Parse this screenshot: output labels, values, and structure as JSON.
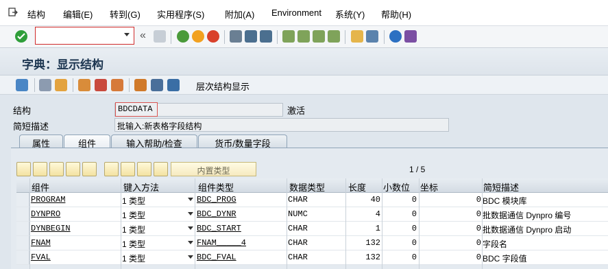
{
  "menu": {
    "items": [
      "结构(S)",
      "编辑(E)",
      "转到(G)",
      "实用程序(S)",
      "附加(A)",
      "Environment",
      "系统(Y)",
      "帮助(H)"
    ]
  },
  "menu_labels": {
    "struct": "结构",
    "edit": "编辑(E)",
    "goto": "转到(G)",
    "util": "实用程序(S)",
    "extras": "附加(A)",
    "env": "Environment",
    "system": "系统(Y)",
    "help": "帮助(H)"
  },
  "toolbar": {
    "command_value": "",
    "back_arrows": "«"
  },
  "title": "字典：显示结构",
  "app_toolbar": {
    "hierarchy_label": "层次结构显示"
  },
  "form": {
    "struct_label": "结构",
    "struct_value": "BDCDATA",
    "status": "激活",
    "desc_label": "简短描述",
    "desc_value": "批输入:新表格字段结构"
  },
  "tabs": [
    "属性",
    "组件",
    "输入帮助/检查",
    "货币/数量字段"
  ],
  "table": {
    "builtin_type_label": "内置类型",
    "pager": "1 / 5",
    "headers": [
      "组件",
      "键入方法",
      "组件类型",
      "数据类型",
      "长度",
      "小数位",
      "坐标",
      "简短描述"
    ],
    "rows": [
      {
        "component": "PROGRAM",
        "method": "1 类型",
        "comp_type": "BDC_PROG",
        "data_type": "CHAR",
        "length": "40",
        "decimals": "0",
        "coord": "0",
        "desc": "BDC 模块库"
      },
      {
        "component": "DYNPRO",
        "method": "1 类型",
        "comp_type": "BDC_DYNR",
        "data_type": "NUMC",
        "length": "4",
        "decimals": "0",
        "coord": "0",
        "desc": "批数据通信 Dynpro 编号"
      },
      {
        "component": "DYNBEGIN",
        "method": "1 类型",
        "comp_type": "BDC_START",
        "data_type": "CHAR",
        "length": "1",
        "decimals": "0",
        "coord": "0",
        "desc": "批数据通信 Dynpro 启动"
      },
      {
        "component": "FNAM",
        "method": "1 类型",
        "comp_type": "FNAM_____4",
        "data_type": "CHAR",
        "length": "132",
        "decimals": "0",
        "coord": "0",
        "desc": "字段名"
      },
      {
        "component": "FVAL",
        "method": "1 类型",
        "comp_type": "BDC_FVAL",
        "data_type": "CHAR",
        "length": "132",
        "decimals": "0",
        "coord": "0",
        "desc": "BDC 字段值"
      }
    ]
  },
  "colors": {
    "title_text": "#1c3550",
    "command_border": "#d02a2a",
    "struct_highlight": "#d9534f"
  }
}
